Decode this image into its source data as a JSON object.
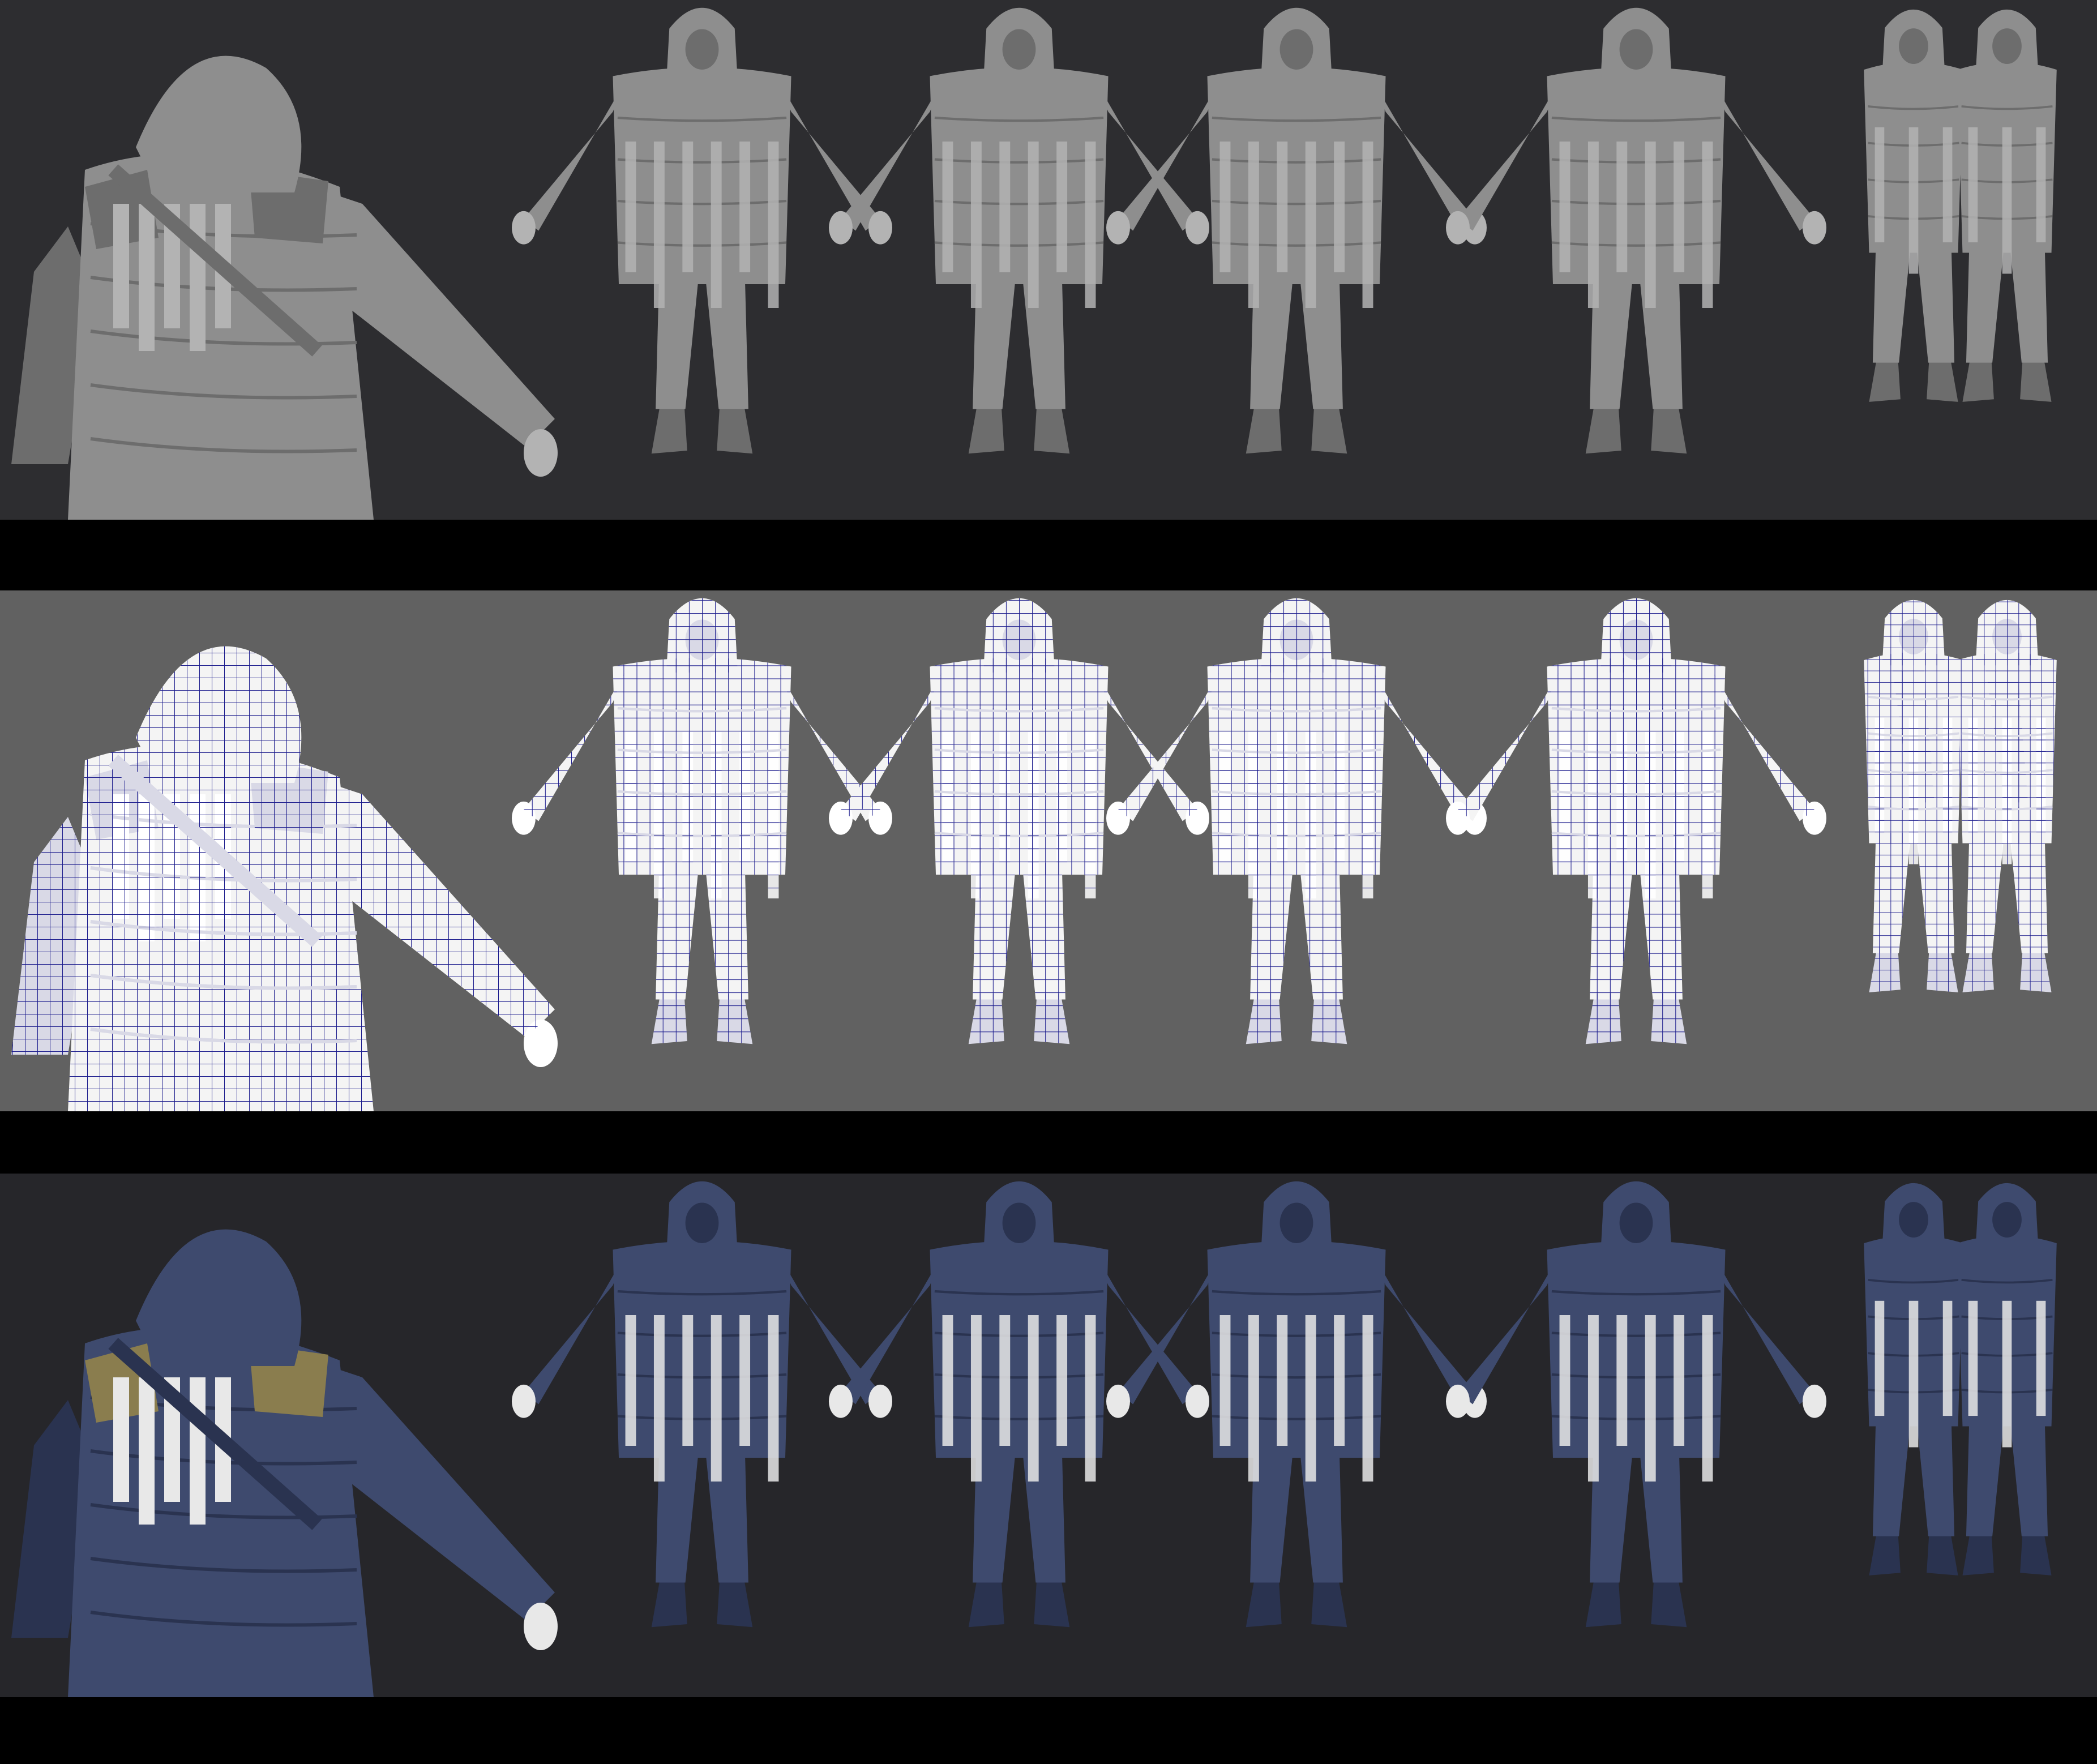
{
  "sheet": {
    "rows": [
      {
        "name": "sculpt-row",
        "shading": "grey-clay",
        "background": "#2d2d30",
        "body": "#8e8e8e",
        "detail": "#6d6d6d",
        "highlight": "#b3b3b3",
        "wire": "none",
        "views": [
          "back-three-quarter-closeup",
          "front-three-quarter",
          "back-three-quarter",
          "front",
          "back",
          "side-left",
          "side-right"
        ]
      },
      {
        "name": "wireframe-row",
        "shading": "white-with-blue-wireframe",
        "background": "#616161",
        "body": "#f4f4f4",
        "detail": "#d9d9e6",
        "highlight": "#ffffff",
        "wire": "#1a1a8c",
        "views": [
          "back-three-quarter-closeup",
          "front-three-quarter",
          "back-three-quarter",
          "front",
          "back",
          "side-left",
          "side-right"
        ]
      },
      {
        "name": "textured-row",
        "shading": "textured",
        "background": "#26262a",
        "body": "#3e4a6e",
        "detail": "#2a3350",
        "highlight": "#e8e8e8",
        "accent": "#8a7d4e",
        "wire": "none",
        "views": [
          "back-three-quarter-closeup",
          "front-three-quarter",
          "back-three-quarter",
          "front",
          "back",
          "side-left",
          "side-right"
        ]
      }
    ],
    "separator_color": "#000000"
  }
}
